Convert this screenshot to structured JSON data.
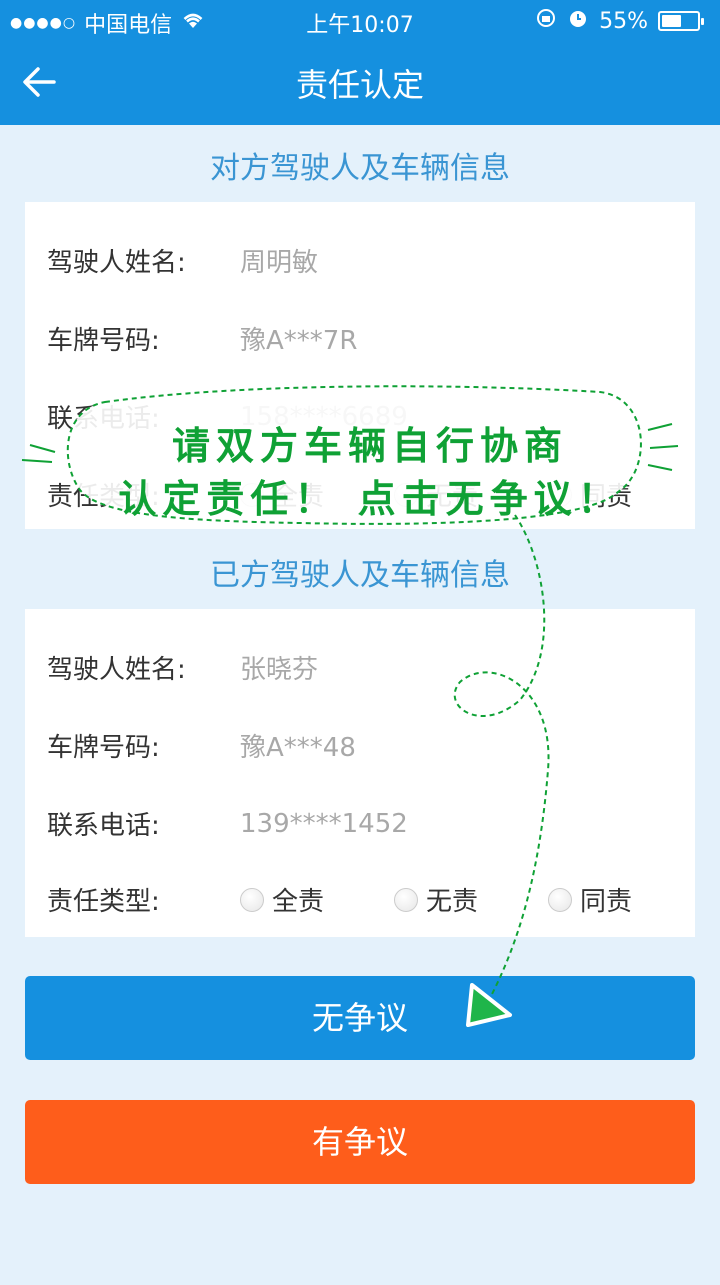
{
  "status_bar": {
    "signal": "●●●●○",
    "carrier": "中国电信",
    "time": "上午10:07",
    "battery_percent": "55%",
    "battery_level": 0.55
  },
  "nav": {
    "title": "责任认定"
  },
  "other_party": {
    "section_title": "对方驾驶人及车辆信息",
    "fields": [
      {
        "label": "驾驶人姓名:",
        "value": "周明敏"
      },
      {
        "label": "车牌号码:",
        "value": "豫A***7R"
      },
      {
        "label": "联系电话:",
        "value": "158****6689"
      }
    ],
    "responsibility": {
      "label": "责任类型:",
      "options": [
        "全责",
        "无责",
        "同责"
      ]
    }
  },
  "own_party": {
    "section_title": "已方驾驶人及车辆信息",
    "fields": [
      {
        "label": "驾驶人姓名:",
        "value": "张晓芬"
      },
      {
        "label": "车牌号码:",
        "value": "豫A***48"
      },
      {
        "label": "联系电话:",
        "value": "139****1452"
      }
    ],
    "responsibility": {
      "label": "责任类型:",
      "options": [
        "全责",
        "无责",
        "同责"
      ]
    }
  },
  "buttons": {
    "no_dispute": "无争议",
    "dispute": "有争议"
  },
  "annotation": {
    "line1": "请双方车辆自行协商",
    "line2": "认定责任！ 点击无争议！",
    "color": "#0fa135"
  }
}
